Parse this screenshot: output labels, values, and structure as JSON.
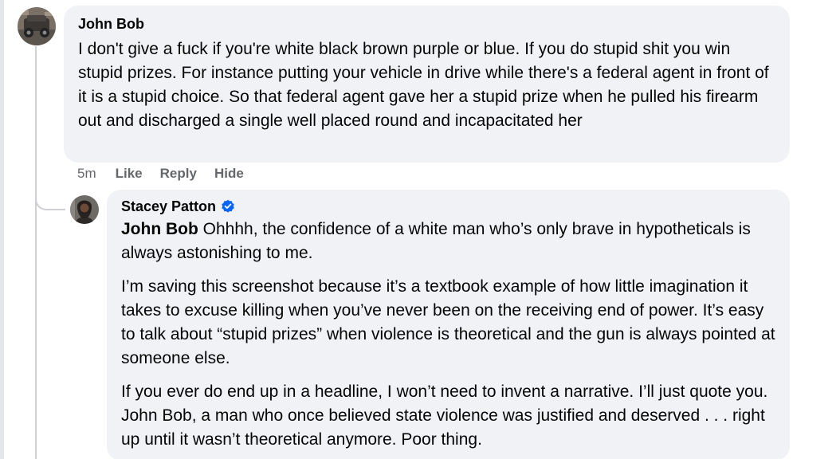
{
  "comments": [
    {
      "author": "John Bob",
      "text": "I don't give a fuck if you're white black brown purple or blue. If you do stupid shit you win stupid prizes. For instance putting your vehicle in drive while there's a federal agent in front of it is a stupid choice. So that federal agent gave her a stupid prize when he pulled his firearm out and discharged a single well placed round and incapacitated her",
      "time": "5m",
      "actions": {
        "like": "Like",
        "reply": "Reply",
        "hide": "Hide"
      }
    }
  ],
  "reply": {
    "author": "Stacey Patton",
    "verified": true,
    "mention": "John Bob",
    "para1_rest": " Ohhhh, the confidence of a white man who’s only brave in hypotheticals is always astonishing to me.",
    "para2": "I’m saving this screenshot because it’s a textbook example of how little imagination it takes to excuse killing when you’ve never been on the receiving end of power. It’s easy to talk about “stupid prizes” when violence is theoretical and the gun is always pointed at someone else.",
    "para3": "If you ever do end up in a headline, I won’t need to invent a narrative. I’ll just quote you. John Bob, a man who once believed state violence was justified and deserved . . . right up until it wasn’t theoretical anymore. Poor thing."
  },
  "colors": {
    "bubble": "#f0f2f5",
    "meta_text": "#65676b",
    "verified_badge": "#0866ff",
    "thread_line": "#ced0d4"
  }
}
